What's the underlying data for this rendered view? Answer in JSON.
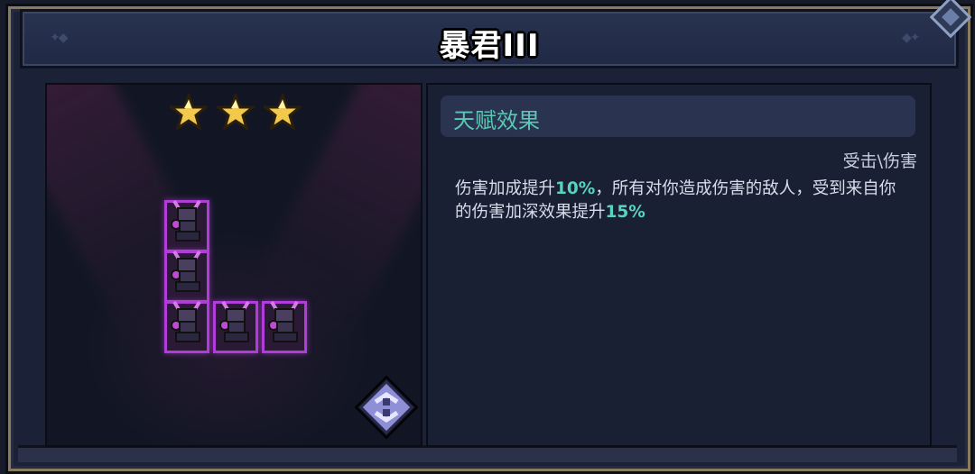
{
  "header": {
    "title": "暴君III"
  },
  "stars": {
    "count": 3,
    "max": 3,
    "color": "#f2c94c"
  },
  "talent": {
    "header": "天赋效果",
    "tag": "受击\\伤害",
    "desc_part1": "伤害加成提升",
    "value1": "10%",
    "desc_part2": "，所有对你造成伤害的敌人，受到来自你的伤害加深效果提升",
    "value2": "15%"
  },
  "colors": {
    "highlight": "#58d3c0",
    "header_text": "#5cc7b5",
    "cell_border": "#b23cd9"
  },
  "icons": {
    "rotate": "rotate-arrows-icon",
    "unit": "demon-turret-icon",
    "star": "star-icon"
  }
}
